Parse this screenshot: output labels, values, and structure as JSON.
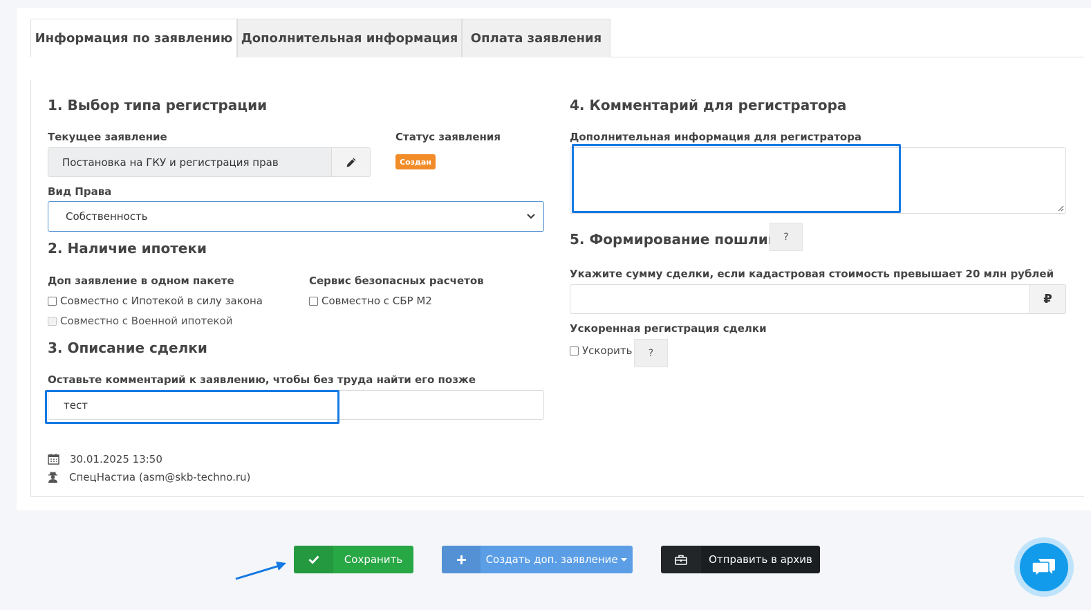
{
  "tabs": [
    {
      "label": "Информация по заявлению",
      "active": true
    },
    {
      "label": "Дополнительная информация",
      "active": false
    },
    {
      "label": "Оплата заявления",
      "active": false
    }
  ],
  "section1": {
    "title": "1. Выбор типа регистрации",
    "current_label": "Текущее заявление",
    "current_value": "Постановка на ГКУ и регистрация прав",
    "status_label": "Статус заявления",
    "status_badge": "Создан",
    "right_type_label": "Вид Права",
    "right_type_value": "Собственность"
  },
  "section2": {
    "title": "2. Наличие ипотеки",
    "extra_label": "Доп заявление в одном пакете",
    "mortgage_law": "Совместно с Ипотекой в силу закона",
    "military_mortgage": "Совместно с Военной ипотекой",
    "safe_label": "Сервис безопасных расчетов",
    "sbr": "Совместно с СБР М2"
  },
  "section3": {
    "title": "3. Описание сделки",
    "comment_label": "Оставьте комментарий к заявлению, чтобы без труда найти его позже",
    "comment_value": "тест"
  },
  "meta": {
    "date": "30.01.2025 13:50",
    "user": "СпецНастиа (asm@skb-techno.ru)"
  },
  "section4": {
    "title": "4. Комментарий для регистратора",
    "info_label": "Дополнительная информация для регистратора",
    "info_value": ""
  },
  "section5": {
    "title": "5. Формирование пошлины",
    "help": "?",
    "amount_label": "Укажите сумму сделки, если кадастровая стоимость превышает 20 млн рублей",
    "amount_value": "",
    "currency": "₽",
    "fast_label": "Ускоренная регистрация сделки",
    "fast_checkbox": "Ускорить",
    "fast_help": "?"
  },
  "buttons": {
    "save": "Сохранить",
    "create": "Создать доп. заявление",
    "archive": "Отправить в архив"
  },
  "colors": {
    "accent_blue": "#1479e3",
    "save_green": "#28a745",
    "create_blue": "#5b9ee6",
    "archive_dark": "#1b1e21",
    "status_orange": "#f28c28",
    "chat_blue": "#129bea"
  },
  "icons": {
    "edit": "pencil-icon",
    "calendar": "calendar-icon",
    "user": "user-secret-icon",
    "save": "check-icon",
    "create": "plus-icon",
    "archive": "briefcase-icon",
    "chat": "chat-icon"
  }
}
